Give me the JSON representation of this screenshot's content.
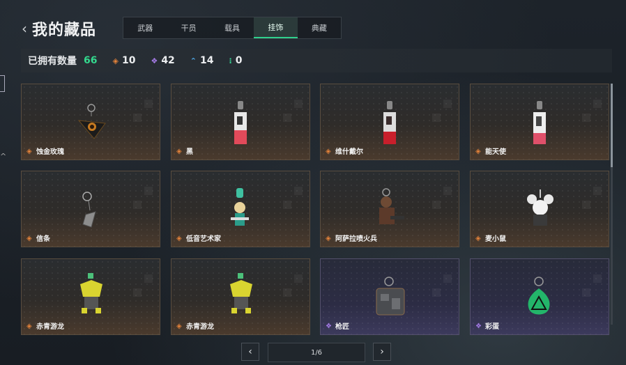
{
  "header": {
    "back_icon": "chevron-left-icon",
    "title": "我的藏品"
  },
  "tabs": [
    {
      "label": "武器",
      "active": false
    },
    {
      "label": "干员",
      "active": false
    },
    {
      "label": "载具",
      "active": false
    },
    {
      "label": "挂饰",
      "active": true
    },
    {
      "label": "典藏",
      "active": false
    }
  ],
  "stats": {
    "label": "已拥有数量",
    "total": "66",
    "items": [
      {
        "icon": "orange-diamond-icon",
        "color": "#e3823a",
        "value": "10"
      },
      {
        "icon": "purple-diamond-icon",
        "color": "#a57be6",
        "value": "42"
      },
      {
        "icon": "blue-chevron-icon",
        "color": "#4fa9e8",
        "value": "14"
      },
      {
        "icon": "green-dots-icon",
        "color": "#37d695",
        "value": "0"
      }
    ]
  },
  "cards": [
    {
      "name": "蚀金玫瑰",
      "rarity": "orange"
    },
    {
      "name": "黑",
      "rarity": "orange"
    },
    {
      "name": "维什戴尔",
      "rarity": "orange"
    },
    {
      "name": "能天使",
      "rarity": "orange"
    },
    {
      "name": "信条",
      "rarity": "orange"
    },
    {
      "name": "低音艺术家",
      "rarity": "orange"
    },
    {
      "name": "阿萨拉喷火兵",
      "rarity": "orange"
    },
    {
      "name": "麦小鼠",
      "rarity": "orange"
    },
    {
      "name": "赤青游龙",
      "rarity": "orange"
    },
    {
      "name": "赤青游龙",
      "rarity": "orange"
    },
    {
      "name": "枪匠",
      "rarity": "purple"
    },
    {
      "name": "彩蛋",
      "rarity": "purple"
    }
  ],
  "pagination": {
    "page_text": "1/6",
    "prev_icon": "chevron-left-icon",
    "next_icon": "chevron-right-icon"
  }
}
